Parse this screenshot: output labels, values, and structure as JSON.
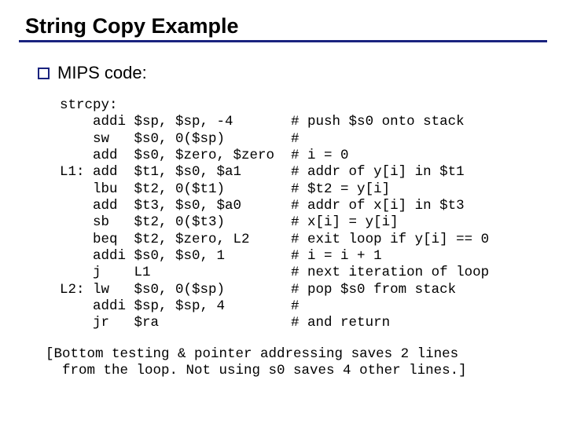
{
  "title": "String Copy Example",
  "bullet": "MIPS code:",
  "code": "strcpy:\n    addi $sp, $sp, -4       # push $s0 onto stack\n    sw   $s0, 0($sp)        #\n    add  $s0, $zero, $zero  # i = 0\nL1: add  $t1, $s0, $a1      # addr of y[i] in $t1\n    lbu  $t2, 0($t1)        # $t2 = y[i]\n    add  $t3, $s0, $a0      # addr of x[i] in $t3\n    sb   $t2, 0($t3)        # x[i] = y[i]\n    beq  $t2, $zero, L2     # exit loop if y[i] == 0\n    addi $s0, $s0, 1        # i = i + 1\n    j    L1                 # next iteration of loop\nL2: lw   $s0, 0($sp)        # pop $s0 from stack\n    addi $sp, $sp, 4        #\n    jr   $ra                # and return",
  "footnote": "[Bottom testing & pointer addressing saves 2 lines\n  from the loop. Not using s0 saves 4 other lines.]"
}
